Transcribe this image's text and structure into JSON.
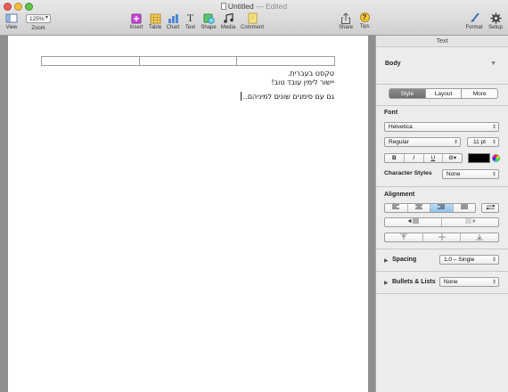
{
  "window": {
    "title": "Untitled",
    "status": "— Edited"
  },
  "toolbar": {
    "view_label": "View",
    "zoom_value": "125%",
    "zoom_label": "Zoom",
    "insert_label": "Insert",
    "table_label": "Table",
    "chart_label": "Chart",
    "text_label": "Text",
    "shape_label": "Shape",
    "media_label": "Media",
    "comment_label": "Comment",
    "share_label": "Share",
    "tips_label": "Tips",
    "format_label": "Format",
    "setup_label": "Setup",
    "tips_glyph": "?",
    "text_glyph": "T"
  },
  "document": {
    "line1": "טקסט בעברית.",
    "line2": "יישור לימין עובד טוב!",
    "line3": "גם עם סימנים שונים למיניהם.."
  },
  "inspector": {
    "header": "Text",
    "paragraph_style": "Body",
    "tabs": [
      "Style",
      "Layout",
      "More"
    ],
    "font_section": "Font",
    "font_family": "Helvetica",
    "font_typeface": "Regular",
    "font_size": "11 pt",
    "bold": "B",
    "italic": "I",
    "underline": "U",
    "gear": "⚙▾",
    "character_styles_label": "Character Styles",
    "character_styles_value": "None",
    "alignment_section": "Alignment",
    "spacing_label": "Spacing",
    "spacing_value": "1.0 – Single",
    "bullets_label": "Bullets & Lists",
    "bullets_value": "None",
    "disclosure": "▶",
    "text_color": "#000000"
  }
}
